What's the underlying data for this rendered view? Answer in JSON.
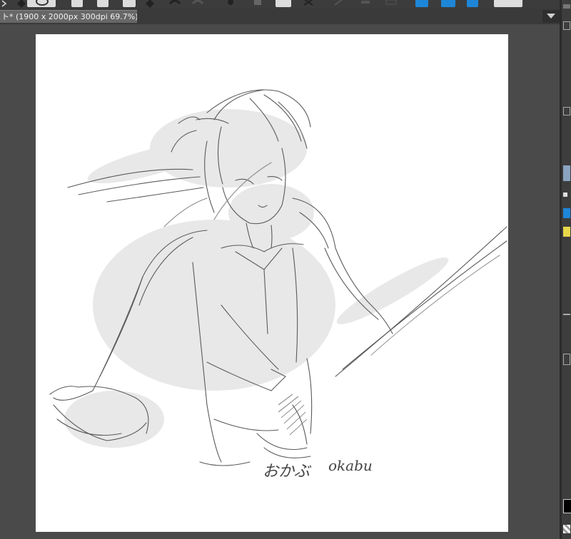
{
  "document_tab": {
    "title": "ト* (1900 x 2000px 300dpi 69.7%)"
  },
  "toolbar": {
    "icons": [
      "arrow-icon",
      "diamond-icon",
      "eye-icon",
      "new-page-icon",
      "copy-icon",
      "save-icon",
      "diamond-icon",
      "undo-icon",
      "redo-icon",
      "settings-icon",
      "stamp-icon",
      "eraser-icon",
      "transform-icon",
      "pen-icon",
      "ruler-icon",
      "grid-icon",
      "layer-icon",
      "frame-icon",
      "info-icon",
      "display-icon"
    ]
  },
  "colors": {
    "accent": "#1e86d8",
    "workspace": "#4a4a4a",
    "paper": "#ffffff"
  },
  "canvas": {
    "signature_japanese": "おかぶ",
    "signature_latin": "okabu"
  }
}
